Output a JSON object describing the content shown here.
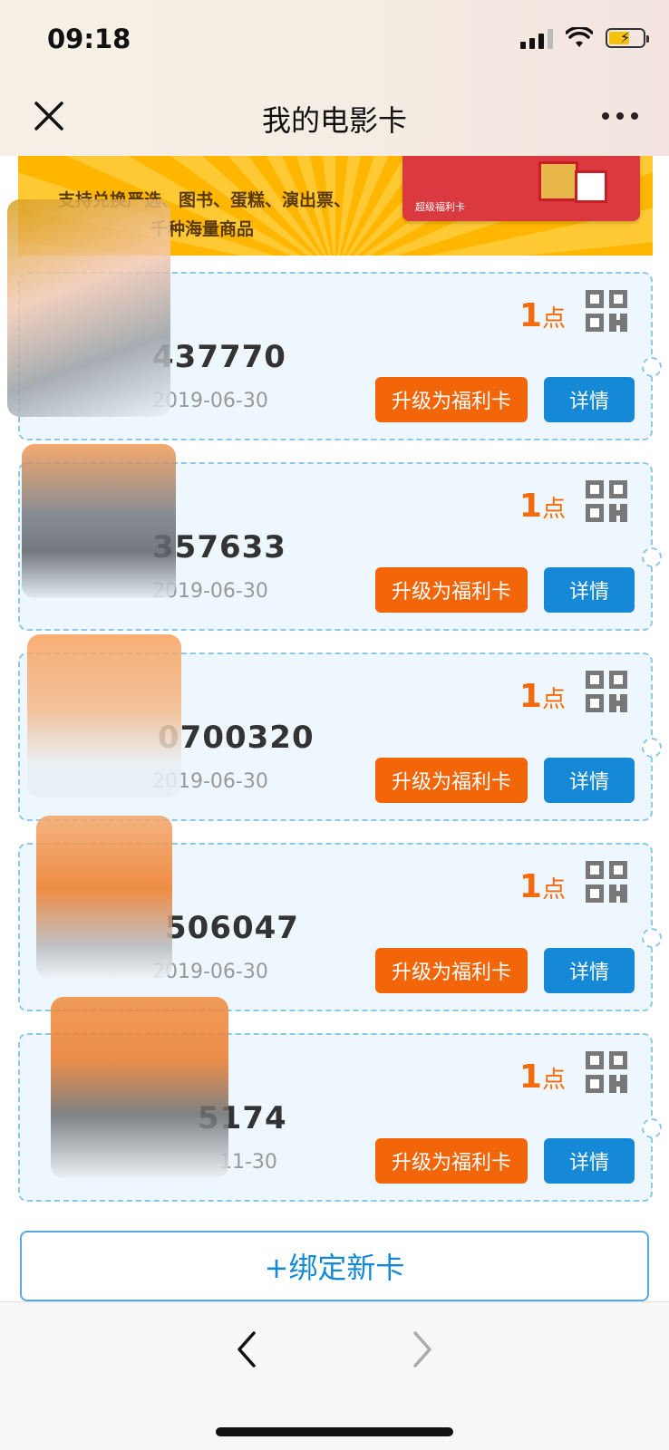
{
  "status_bar": {
    "time": "09:18"
  },
  "header": {
    "title": "我的电影卡",
    "close_icon": "close-icon",
    "more_icon": "more-icon"
  },
  "banner": {
    "line1": "支持兑换严选、图书、蛋糕、演出票、",
    "line2": "千种海量商品",
    "card_label": "超级福利卡"
  },
  "cards": [
    {
      "points_value": "1",
      "points_unit": "点",
      "number": "437770",
      "expiry": "2019-06-30",
      "upgrade_label": "升级为福利卡",
      "detail_label": "详情"
    },
    {
      "points_value": "1",
      "points_unit": "点",
      "number": "357633",
      "expiry": "2019-06-30",
      "upgrade_label": "升级为福利卡",
      "detail_label": "详情"
    },
    {
      "points_value": "1",
      "points_unit": "点",
      "number": "0700320",
      "expiry": "2019-06-30",
      "upgrade_label": "升级为福利卡",
      "detail_label": "详情"
    },
    {
      "points_value": "1",
      "points_unit": "点",
      "number": "506047",
      "expiry": "2019-06-30",
      "upgrade_label": "升级为福利卡",
      "detail_label": "详情"
    },
    {
      "points_value": "1",
      "points_unit": "点",
      "number": "5174",
      "expiry": "11-30",
      "upgrade_label": "升级为福利卡",
      "detail_label": "详情"
    }
  ],
  "bind_button": {
    "label": "+绑定新卡"
  },
  "toolbar": {
    "back_icon": "chevron-left-icon",
    "forward_icon": "chevron-right-icon"
  },
  "colors": {
    "accent_orange": "#f26508",
    "accent_blue": "#1588d6",
    "card_bg": "#eef7fe"
  }
}
